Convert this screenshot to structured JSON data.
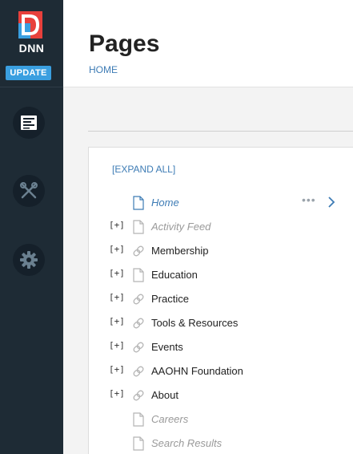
{
  "brand": {
    "logo_text": "DNN",
    "update_label": "UPDATE",
    "colors": {
      "sidebar": "#1e2b35",
      "accent": "#3a9fe0",
      "logo_red": "#e8403c",
      "logo_blue": "#3a9fe0",
      "link": "#3e7cb5"
    }
  },
  "sidebar": {
    "items": [
      {
        "icon": "pages-icon"
      },
      {
        "icon": "tools-icon"
      },
      {
        "icon": "gear-icon"
      }
    ]
  },
  "header": {
    "title": "Pages",
    "breadcrumb": "HOME"
  },
  "tree": {
    "expand_all_label": "[EXPAND ALL]",
    "expander_label": "[+]",
    "items": [
      {
        "label": "Home",
        "icon": "page-icon",
        "expandable": false,
        "state": "selected"
      },
      {
        "label": "Activity Feed",
        "icon": "page-icon",
        "expandable": true,
        "state": "disabled"
      },
      {
        "label": "Membership",
        "icon": "link-icon",
        "expandable": true,
        "state": "normal"
      },
      {
        "label": "Education",
        "icon": "page-icon",
        "expandable": true,
        "state": "normal"
      },
      {
        "label": "Practice",
        "icon": "link-icon",
        "expandable": true,
        "state": "normal"
      },
      {
        "label": "Tools & Resources",
        "icon": "link-icon",
        "expandable": true,
        "state": "normal"
      },
      {
        "label": "Events",
        "icon": "link-icon",
        "expandable": true,
        "state": "normal"
      },
      {
        "label": "AAOHN Foundation",
        "icon": "link-icon",
        "expandable": true,
        "state": "normal"
      },
      {
        "label": "About",
        "icon": "link-icon",
        "expandable": true,
        "state": "normal"
      },
      {
        "label": "Careers",
        "icon": "page-icon",
        "expandable": false,
        "state": "disabled"
      },
      {
        "label": "Search Results",
        "icon": "page-icon",
        "expandable": false,
        "state": "disabled"
      }
    ]
  }
}
